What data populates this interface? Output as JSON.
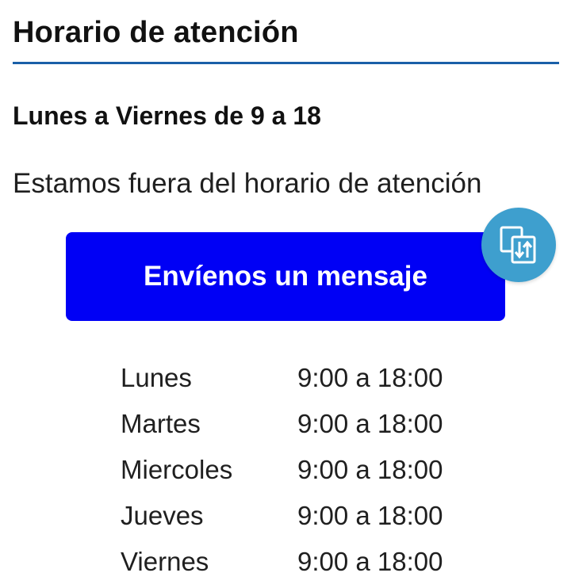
{
  "header": {
    "title": "Horario de atención",
    "accent_color": "#1a5fa8"
  },
  "schedule_summary": "Lunes a Viernes de 9 a 18",
  "status_message": "Estamos fuera del horario de atención",
  "cta": {
    "label": "Envíenos un mensaje",
    "color": "#0000f5"
  },
  "floating_action": {
    "icon": "swap-screen-icon",
    "color": "#3e9fce"
  },
  "hours": [
    {
      "day": "Lunes",
      "time": "9:00 a 18:00"
    },
    {
      "day": "Martes",
      "time": "9:00 a 18:00"
    },
    {
      "day": "Miercoles",
      "time": "9:00 a 18:00"
    },
    {
      "day": "Jueves",
      "time": "9:00 a 18:00"
    },
    {
      "day": "Viernes",
      "time": "9:00 a 18:00"
    }
  ]
}
